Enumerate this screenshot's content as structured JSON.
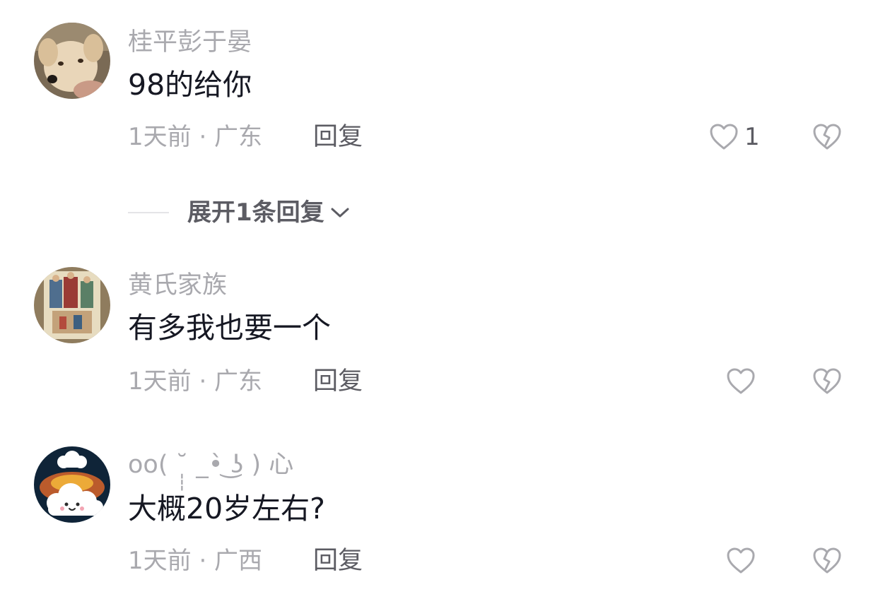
{
  "comments": [
    {
      "username": "桂平彭于晏",
      "text": "98的给你",
      "meta": "1天前 · 广东",
      "reply_label": "回复",
      "like_count": "1",
      "avatar_icon": "dog-photo-avatar",
      "expand_label": "展开1条回复"
    },
    {
      "username": "黄氏家族",
      "text": "有多我也要一个",
      "meta": "1天前 · 广东",
      "reply_label": "回复",
      "like_count": "",
      "avatar_icon": "painting-avatar"
    },
    {
      "username": "oo( ˘̩̩̩ _•̀ ͜ʖ ) 心",
      "text": "大概20岁左右?",
      "meta": "1天前 · 广西",
      "reply_label": "回复",
      "like_count": "",
      "avatar_icon": "cloud-avatar"
    }
  ],
  "colors": {
    "primary_text": "#161823",
    "secondary_text": "#a9a9ae",
    "action_text": "#5c5c63",
    "icon_stroke": "#a9a9ae",
    "background": "#ffffff"
  }
}
